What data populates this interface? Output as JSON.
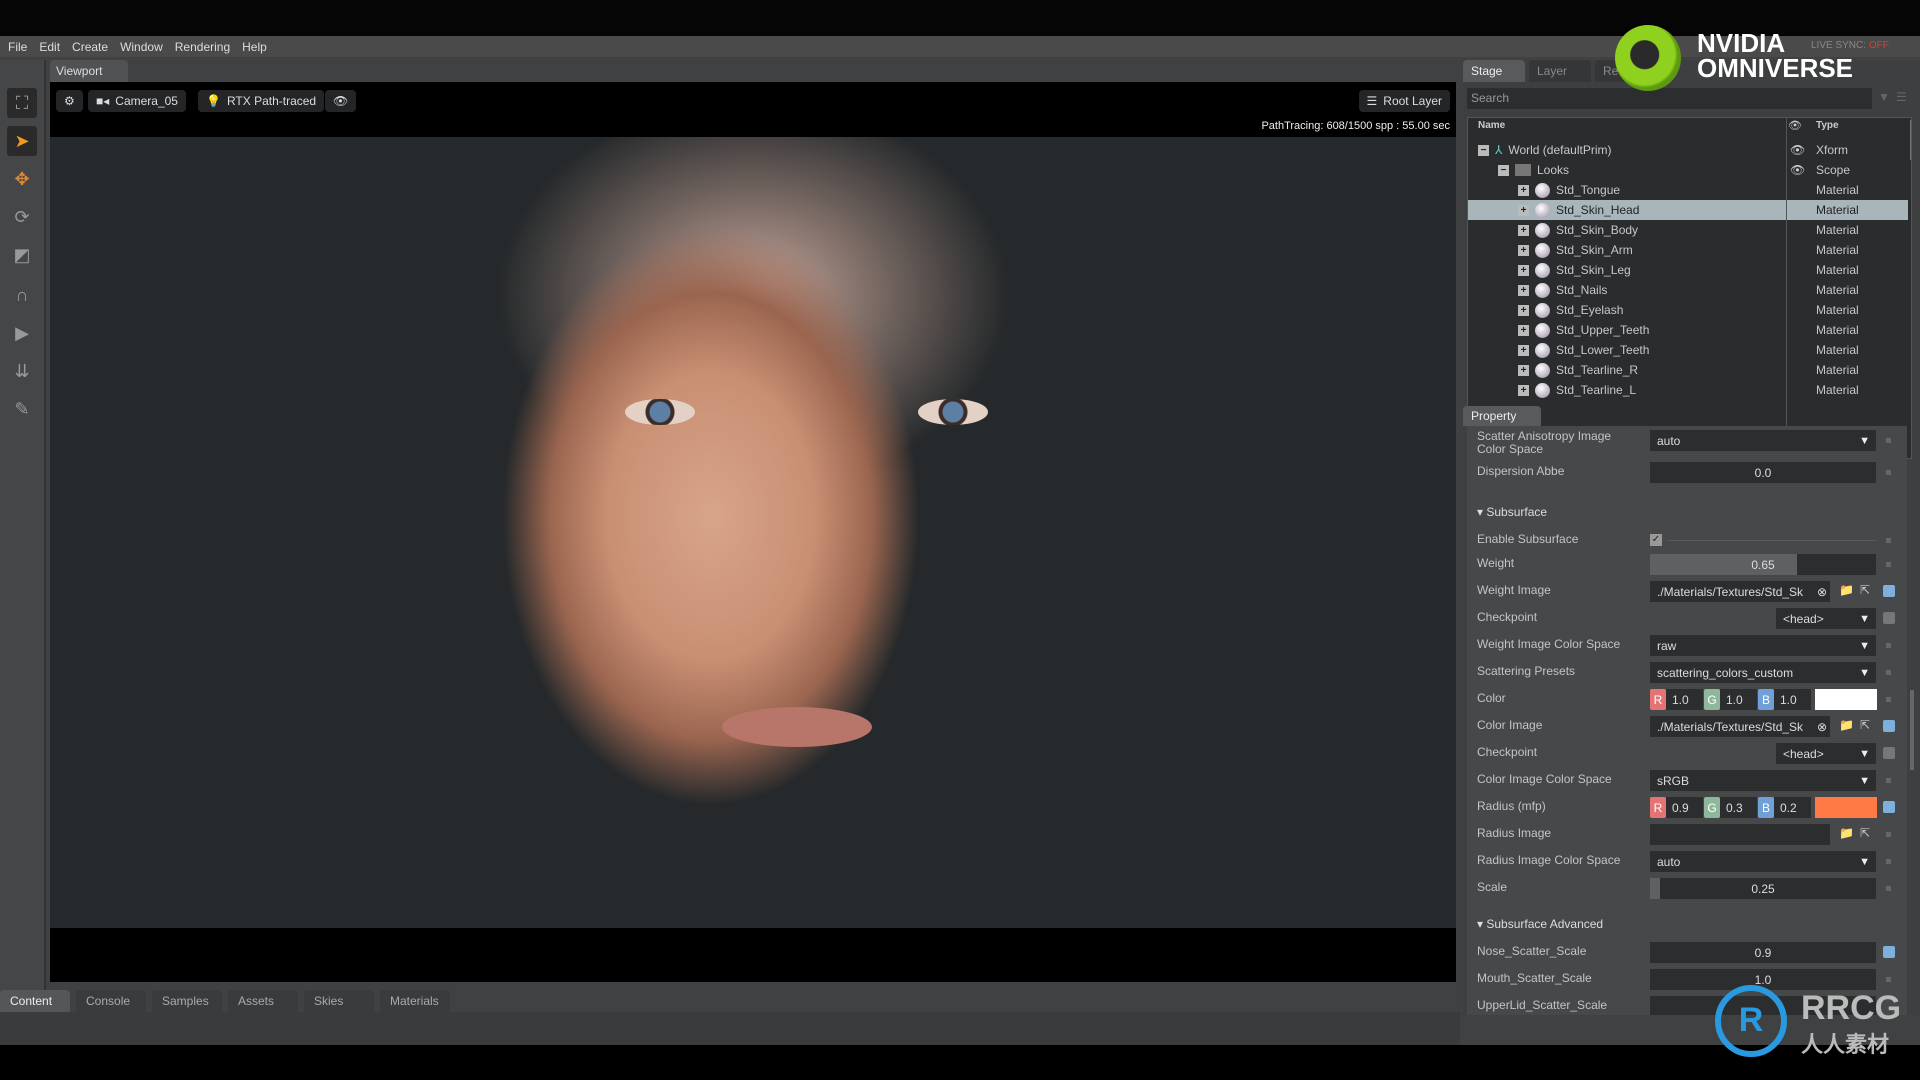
{
  "menu": [
    "File",
    "Edit",
    "Create",
    "Window",
    "Rendering",
    "Help"
  ],
  "logo": {
    "line1": "NVIDIA",
    "line2": "OMNIVERSE",
    "live_sync": "LIVE SYNC:",
    "live_sync_state": "OFF",
    "brand_color": "#76b900"
  },
  "viewport": {
    "tab": "Viewport",
    "camera": "Camera_05",
    "renderer": "RTX Path-traced",
    "layer": "Root Layer",
    "status": "PathTracing: 608/1500 spp : 55.00 sec"
  },
  "bottom_tabs": [
    "Content",
    "Console",
    "Samples",
    "Assets",
    "Skies",
    "Materials"
  ],
  "stage": {
    "tabs": [
      "Stage",
      "Layer",
      "Re"
    ],
    "search_placeholder": "Search",
    "col_name": "Name",
    "col_type": "Type",
    "rows": [
      {
        "name": "World (defaultPrim)",
        "type": "Xform",
        "level": 0,
        "icon": "xform-axis-icon",
        "visible": true
      },
      {
        "name": "Looks",
        "type": "Scope",
        "level": 1,
        "icon": "folder-icon",
        "visible": true
      },
      {
        "name": "Std_Tongue",
        "type": "Material",
        "level": 2
      },
      {
        "name": "Std_Skin_Head",
        "type": "Material",
        "level": 2,
        "selected": true
      },
      {
        "name": "Std_Skin_Body",
        "type": "Material",
        "level": 2
      },
      {
        "name": "Std_Skin_Arm",
        "type": "Material",
        "level": 2
      },
      {
        "name": "Std_Skin_Leg",
        "type": "Material",
        "level": 2
      },
      {
        "name": "Std_Nails",
        "type": "Material",
        "level": 2
      },
      {
        "name": "Std_Eyelash",
        "type": "Material",
        "level": 2
      },
      {
        "name": "Std_Upper_Teeth",
        "type": "Material",
        "level": 2
      },
      {
        "name": "Std_Lower_Teeth",
        "type": "Material",
        "level": 2
      },
      {
        "name": "Std_Tearline_R",
        "type": "Material",
        "level": 2
      },
      {
        "name": "Std_Tearline_L",
        "type": "Material",
        "level": 2
      }
    ]
  },
  "property": {
    "tab": "Property",
    "scatter_aniso_label": "Scatter Anisotropy Image\nColor Space",
    "scatter_aniso_value": "auto",
    "dispersion_label": "Dispersion Abbe",
    "dispersion_value": "0.0",
    "subsurface": "Subsurface",
    "enable_label": "Enable Subsurface",
    "enable_checked": true,
    "weight_label": "Weight",
    "weight_value": "0.65",
    "weight_fraction": 0.65,
    "weight_image_label": "Weight Image",
    "weight_image_value": "./Materials/Textures/Std_Sk",
    "checkpoint_label": "Checkpoint",
    "checkpoint_value": "<head>",
    "wics_label": "Weight Image Color Space",
    "wics_value": "raw",
    "presets_label": "Scattering Presets",
    "presets_value": "scattering_colors_custom",
    "color_label": "Color",
    "color_r": "1.0",
    "color_g": "1.0",
    "color_b": "1.0",
    "color_swatch": "#ffffff",
    "color_image_label": "Color Image",
    "color_image_value": "./Materials/Textures/Std_Sk",
    "checkpoint2_label": "Checkpoint",
    "checkpoint2_value": "<head>",
    "cics_label": "Color Image Color Space",
    "cics_value": "sRGB",
    "radius_label": "Radius (mfp)",
    "radius_r": "0.9",
    "radius_g": "0.3",
    "radius_b": "0.2",
    "radius_swatch": "#ff7a45",
    "radius_image_label": "Radius Image",
    "rics_label": "Radius Image Color Space",
    "rics_value": "auto",
    "scale_label": "Scale",
    "scale_value": "0.25",
    "advanced": "Subsurface Advanced",
    "nose_label": "Nose_Scatter_Scale",
    "nose_value": "0.9",
    "mouth_label": "Mouth_Scatter_Scale",
    "mouth_value": "1.0",
    "upperlid_label": "UpperLid_Scatter_Scale",
    "ch_r": "R",
    "ch_g": "G",
    "ch_b": "B"
  },
  "watermark": {
    "text1": "RRCG",
    "text2": "人人素材"
  }
}
